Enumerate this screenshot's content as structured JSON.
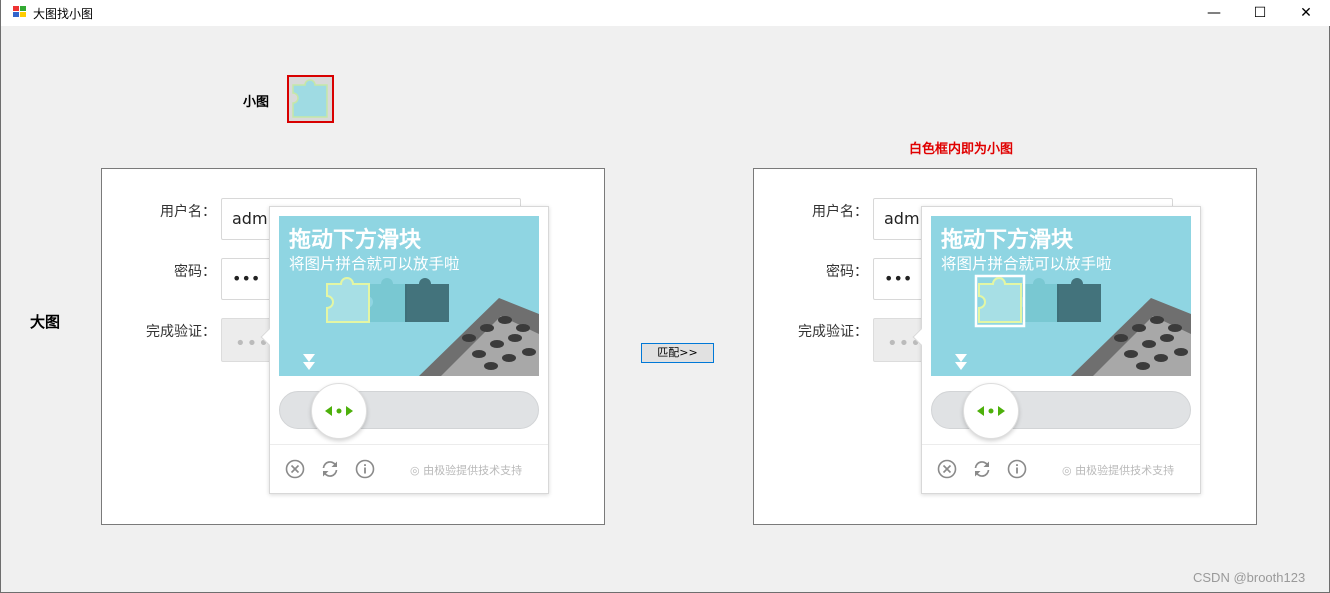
{
  "window": {
    "title": "大图找小图",
    "minimize_glyph": "—",
    "maximize_glyph": "☐",
    "close_glyph": "✕"
  },
  "labels": {
    "small_image": "小图",
    "big_image": "大图",
    "note": "白色框内即为小图"
  },
  "match_button": "匹配>>",
  "panels": [
    {
      "username_label": "用户名：",
      "username_value": "adm",
      "password_label": "密码：",
      "password_value": "•••",
      "verify_label": "完成验证：",
      "captcha_title": "拖动下方滑块",
      "captcha_subtitle": "将图片拼合就可以放手啦",
      "powered_by": "由极验提供技术支持"
    },
    {
      "username_label": "用户名：",
      "username_value": "adm",
      "password_label": "密码：",
      "password_value": "•••",
      "verify_label": "完成验证：",
      "captcha_title": "拖动下方滑块",
      "captcha_subtitle": "将图片拼合就可以放手啦",
      "powered_by": "由极验提供技术支持"
    }
  ],
  "watermark": "CSDN @brooth123",
  "colors": {
    "accent_red": "#e00000",
    "captcha_sky": "#8fd5e2",
    "slider_green": "#4db00b"
  }
}
